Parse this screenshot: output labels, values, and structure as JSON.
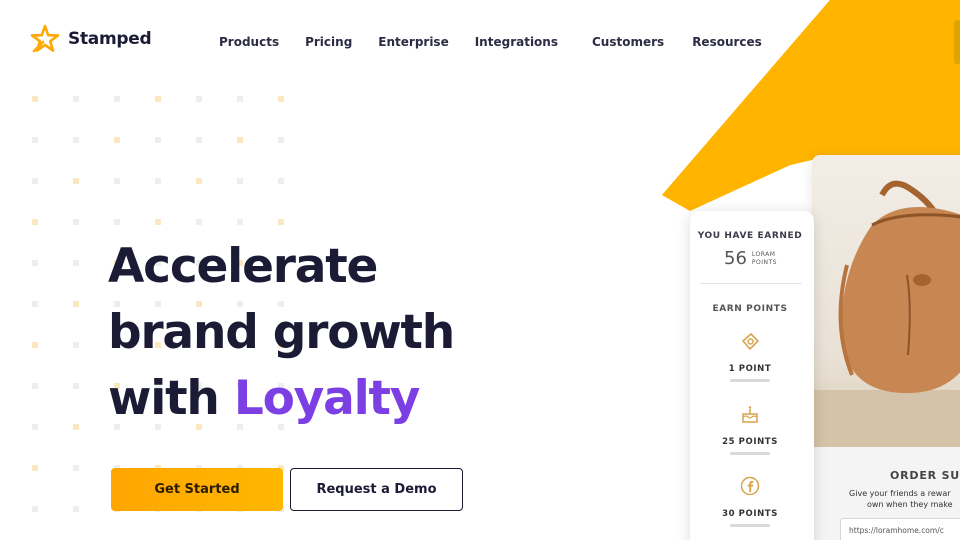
{
  "brand": {
    "name": "Stamped",
    "accent_color": "#ffb100",
    "purple": "#7b3fe4"
  },
  "nav": {
    "items": [
      {
        "label": "Products"
      },
      {
        "label": "Pricing"
      },
      {
        "label": "Enterprise"
      },
      {
        "label": "Integrations"
      },
      {
        "label": "Customers"
      },
      {
        "label": "Resources"
      }
    ]
  },
  "hero": {
    "line1": "Accelerate",
    "line2": "brand growth",
    "line3_prefix": "with ",
    "line3_accent": "Loyalty",
    "primary_cta": "Get Started",
    "secondary_cta": "Request a Demo"
  },
  "loyalty_card": {
    "earned_label": "YOU HAVE EARNED",
    "points": "56",
    "points_unit_line1": "LORAM",
    "points_unit_line2": "POINTS",
    "earn_label": "EARN POINTS",
    "ways": [
      {
        "icon": "ticket-icon",
        "points": "1 POINT"
      },
      {
        "icon": "cake-icon",
        "points": "25 POINTS"
      },
      {
        "icon": "facebook-icon",
        "points": "30 POINTS"
      }
    ]
  },
  "product_panel": {
    "order_title": "ORDER SUC",
    "order_text_line1": "Give your friends a rewar",
    "order_text_line2": "own when they make",
    "url": "https://loramhome.com/c"
  }
}
